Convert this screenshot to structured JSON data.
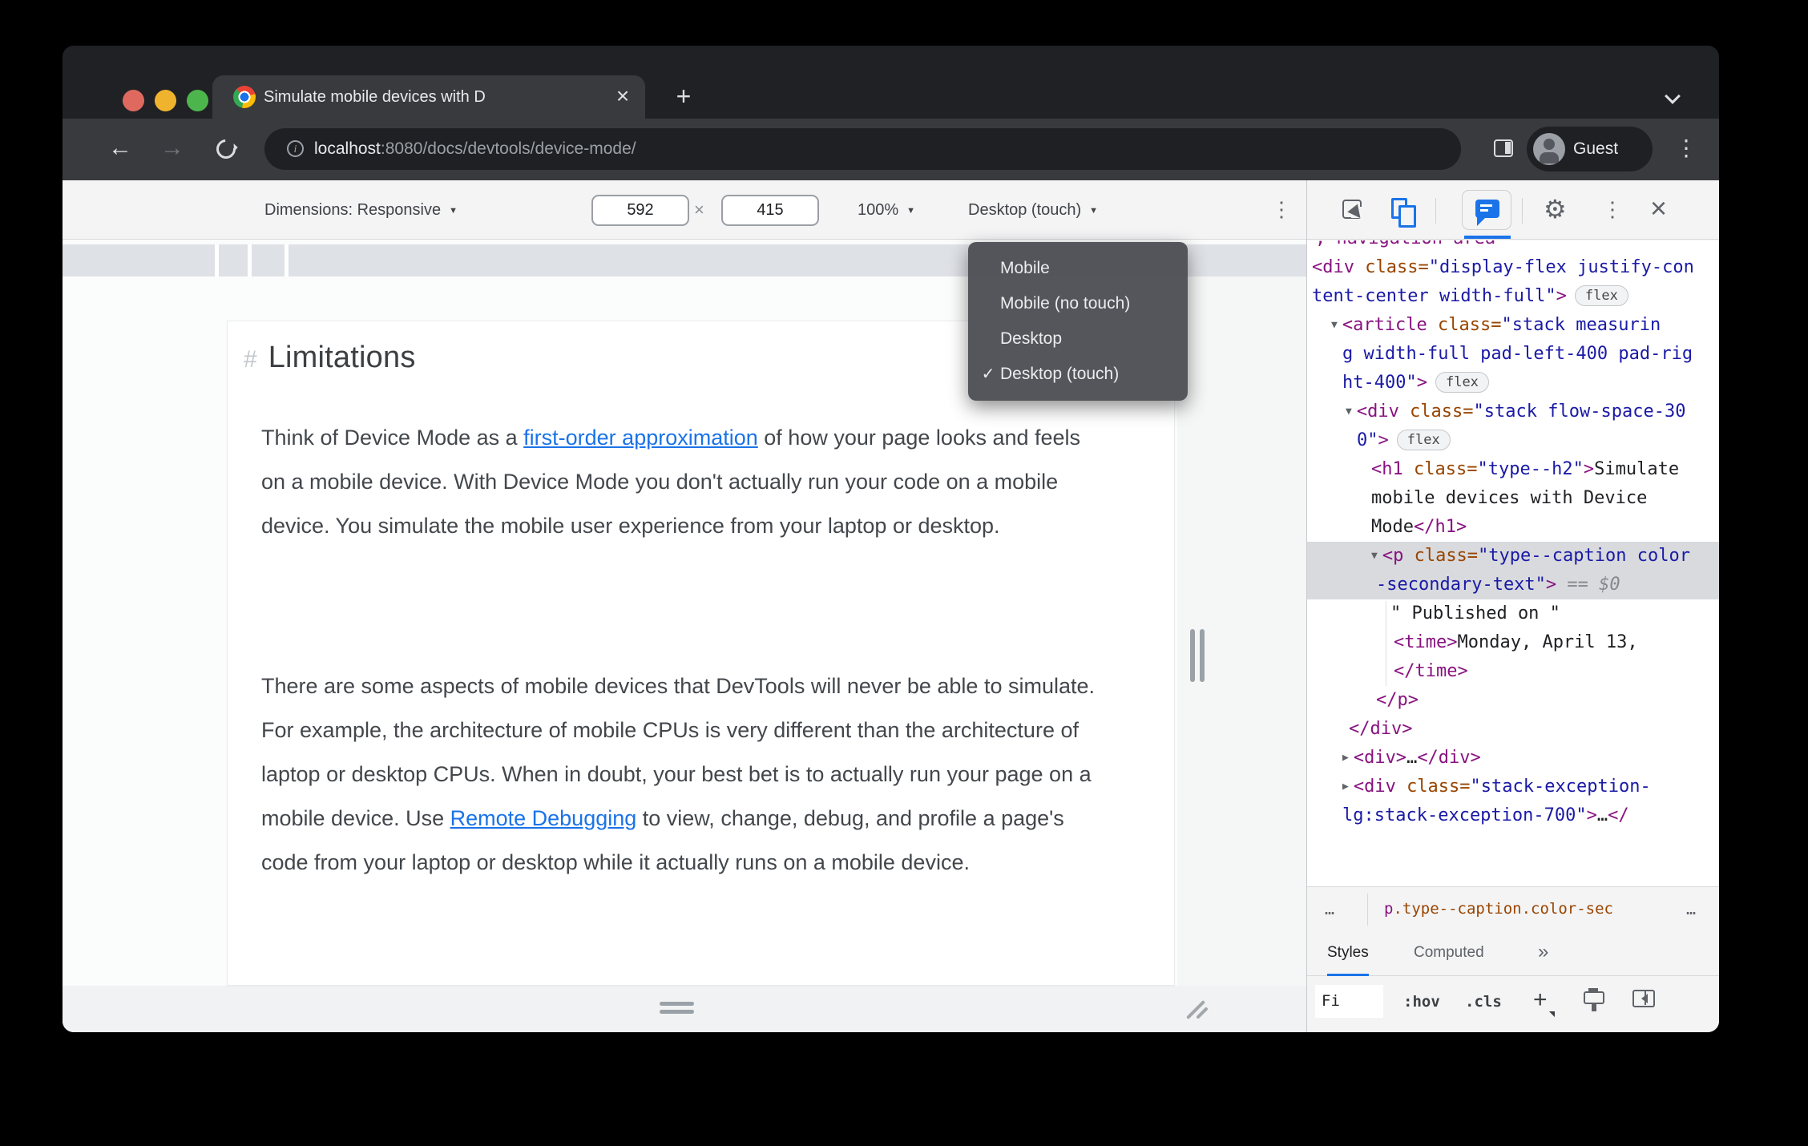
{
  "window": {
    "tab_title": "Simulate mobile devices with D",
    "new_tab_label": "+",
    "close_tab_label": "×"
  },
  "address_bar": {
    "url_host": "localhost",
    "url_rest": ":8080/docs/devtools/device-mode/",
    "guest_label": "Guest",
    "back_glyph": "←",
    "forward_glyph": "→",
    "menu_glyph": "⋮",
    "info_glyph": "i"
  },
  "device_toolbar": {
    "dimensions_label": "Dimensions: Responsive",
    "width_value": "592",
    "times": "×",
    "height_value": "415",
    "zoom_value": "100%",
    "device_type": "Desktop (touch)",
    "caret": "▼",
    "menu_glyph": "⋮"
  },
  "device_menu": {
    "items": [
      "Mobile",
      "Mobile (no touch)",
      "Desktop",
      "Desktop (touch)"
    ],
    "checked_index": 3,
    "check_glyph": "✓"
  },
  "page": {
    "heading_hash": "#",
    "heading": "Limitations",
    "paragraphs": [
      [
        {
          "t": "Think of Device Mode as a "
        },
        {
          "t": "first-order approximation",
          "link": true
        },
        {
          "t": " of how your page looks and feels on a mobile device. With Device Mode you don't actually run your code on a mobile device. You simulate the mobile user experience from your laptop or desktop."
        }
      ],
      [
        {
          "t": "There are some aspects of mobile devices that DevTools will never be able to simulate. For example, the architecture of mobile CPUs is very different than the architecture of laptop or desktop CPUs. When in doubt, your best bet is to actually run your page on a mobile device. Use "
        },
        {
          "t": "Remote Debugging",
          "link": true
        },
        {
          "t": " to view, change, debug, and profile a page's code from your laptop or desktop while it actually runs on a mobile device."
        }
      ]
    ]
  },
  "devtools": {
    "toolbar": {
      "settings_glyph": "⚙",
      "menu_glyph": "⋮",
      "close_glyph": "×"
    },
    "code_lines": [
      {
        "clip": true,
        "indent": 10,
        "segs": [
          {
            "c": "g",
            "t": ", navigation-area"
          }
        ]
      },
      {
        "indent": 6,
        "segs": [
          {
            "c": "g",
            "t": "<div "
          },
          {
            "c": "a",
            "t": "class="
          },
          {
            "c": "v",
            "t": "\"display-flex justify-con"
          }
        ]
      },
      {
        "indent": 6,
        "badge": "flex",
        "segs": [
          {
            "c": "v",
            "t": "tent-center width-full\""
          },
          {
            "c": "g",
            "t": ">"
          }
        ]
      },
      {
        "indent": 30,
        "arrow": "open",
        "segs": [
          {
            "c": "g",
            "t": "<article "
          },
          {
            "c": "a",
            "t": "class="
          },
          {
            "c": "v",
            "t": "\"stack measurin"
          }
        ]
      },
      {
        "indent": 44,
        "segs": [
          {
            "c": "v",
            "t": "g width-full pad-left-400 pad-rig"
          }
        ]
      },
      {
        "indent": 44,
        "badge": "flex",
        "segs": [
          {
            "c": "v",
            "t": "ht-400\""
          },
          {
            "c": "g",
            "t": ">"
          }
        ]
      },
      {
        "indent": 48,
        "arrow": "open",
        "segs": [
          {
            "c": "g",
            "t": "<div "
          },
          {
            "c": "a",
            "t": "class="
          },
          {
            "c": "v",
            "t": "\"stack flow-space-30"
          }
        ]
      },
      {
        "indent": 62,
        "badge": "flex",
        "segs": [
          {
            "c": "v",
            "t": "0\""
          },
          {
            "c": "g",
            "t": ">"
          }
        ]
      },
      {
        "indent": 80,
        "segs": [
          {
            "c": "g",
            "t": "<h1 "
          },
          {
            "c": "a",
            "t": "class="
          },
          {
            "c": "v",
            "t": "\"type--h2\""
          },
          {
            "c": "g",
            "t": ">"
          },
          {
            "c": "t",
            "t": "Simulate"
          }
        ]
      },
      {
        "indent": 80,
        "segs": [
          {
            "c": "t",
            "t": "mobile devices with Device"
          }
        ]
      },
      {
        "indent": 80,
        "segs": [
          {
            "c": "t",
            "t": "Mode"
          },
          {
            "c": "g",
            "t": "</h1>"
          }
        ]
      },
      {
        "indent": 80,
        "arrow": "open",
        "selected": true,
        "segs": [
          {
            "c": "g",
            "t": "<p "
          },
          {
            "c": "a",
            "t": "class="
          },
          {
            "c": "v",
            "t": "\"type--caption color"
          }
        ]
      },
      {
        "indent": 86,
        "selected": true,
        "segs": [
          {
            "c": "v",
            "t": "-secondary-text\""
          },
          {
            "c": "g",
            "t": ">"
          },
          {
            "c": "y",
            "t": " == "
          },
          {
            "c": "i",
            "t": "$0"
          }
        ]
      },
      {
        "indent": 104,
        "segs": [
          {
            "c": "t",
            "t": "\" Published on \""
          }
        ]
      },
      {
        "indent": 108,
        "segs": [
          {
            "c": "g",
            "t": "<time>"
          },
          {
            "c": "t",
            "t": "Monday, April 13,"
          }
        ]
      },
      {
        "indent": 108,
        "segs": [
          {
            "c": "g",
            "t": "</time>"
          }
        ]
      },
      {
        "indent": 86,
        "segs": [
          {
            "c": "g",
            "t": "</p>"
          }
        ]
      },
      {
        "indent": 52,
        "segs": [
          {
            "c": "g",
            "t": "</div>"
          }
        ]
      },
      {
        "indent": 44,
        "arrow": "closed",
        "segs": [
          {
            "c": "g",
            "t": "<div>"
          },
          {
            "c": "t",
            "t": "…"
          },
          {
            "c": "g",
            "t": "</div>"
          }
        ]
      },
      {
        "indent": 44,
        "arrow": "closed",
        "segs": [
          {
            "c": "g",
            "t": "<div "
          },
          {
            "c": "a",
            "t": "class="
          },
          {
            "c": "v",
            "t": "\"stack-exception-"
          }
        ]
      },
      {
        "indent": 44,
        "segs": [
          {
            "c": "v",
            "t": "lg:stack-exception-700\""
          },
          {
            "c": "g",
            "t": ">"
          },
          {
            "c": "t",
            "t": "…"
          },
          {
            "c": "g",
            "t": "</"
          }
        ]
      }
    ],
    "crumbs": {
      "left_ellipsis": "…",
      "tag": "p",
      "classes": ".type--caption.color-sec",
      "right_ellipsis": "…"
    },
    "tabs": {
      "styles": "Styles",
      "computed": "Computed",
      "more": "»"
    },
    "filter": {
      "filter_text": "Fi",
      "hov": ":hov",
      "cls": ".cls",
      "plus": "+"
    }
  },
  "colors": {
    "accent_blue": "#1a73e8",
    "code_tag": "#881280",
    "code_attr": "#994500",
    "code_value": "#1a1aa6",
    "selection_gray": "#d8dadd",
    "traffic_red": "#e0695f",
    "traffic_yellow": "#f0b32d",
    "traffic_green": "#4cb64c"
  }
}
